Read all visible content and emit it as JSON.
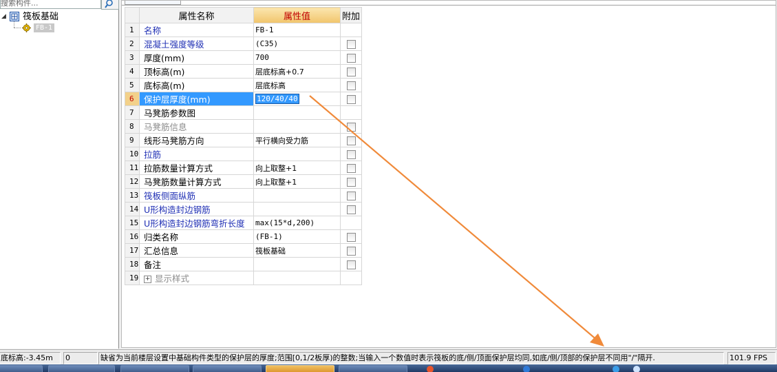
{
  "tree": {
    "search_placeholder": "搜索构件...",
    "root_label": "筏板基础",
    "child_label": "FB-1"
  },
  "grid": {
    "headers": {
      "name": "属性名称",
      "value": "属性值",
      "attach": "附加"
    },
    "rows": [
      {
        "num": "1",
        "name": "名称",
        "value": "FB-1"
      },
      {
        "num": "2",
        "name": "混凝土强度等级",
        "value": "(C35)"
      },
      {
        "num": "3",
        "name": "厚度(mm)",
        "value": "700"
      },
      {
        "num": "4",
        "name": "顶标高(m)",
        "value": "层底标高+0.7"
      },
      {
        "num": "5",
        "name": "底标高(m)",
        "value": "层底标高"
      },
      {
        "num": "6",
        "name": "保护层厚度(mm)",
        "value": "120/40/40"
      },
      {
        "num": "7",
        "name": "马凳筋参数图",
        "value": ""
      },
      {
        "num": "8",
        "name": "马凳筋信息",
        "value": ""
      },
      {
        "num": "9",
        "name": "线形马凳筋方向",
        "value": "平行横向受力筋"
      },
      {
        "num": "10",
        "name": "拉筋",
        "value": ""
      },
      {
        "num": "11",
        "name": "拉筋数量计算方式",
        "value": "向上取整+1"
      },
      {
        "num": "12",
        "name": "马凳筋数量计算方式",
        "value": "向上取整+1"
      },
      {
        "num": "13",
        "name": "筏板侧面纵筋",
        "value": ""
      },
      {
        "num": "14",
        "name": "U形构造封边钢筋",
        "value": ""
      },
      {
        "num": "15",
        "name": "U形构造封边钢筋弯折长度",
        "value": "max(15*d,200)"
      },
      {
        "num": "16",
        "name": "归类名称",
        "value": "(FB-1)"
      },
      {
        "num": "17",
        "name": "汇总信息",
        "value": "筏板基础"
      },
      {
        "num": "18",
        "name": "备注",
        "value": ""
      },
      {
        "num": "19",
        "name": "显示样式",
        "value": ""
      }
    ]
  },
  "status": {
    "elevation": "底标高:-3.45m",
    "value": "0",
    "hint": "缺省为当前楼层设置中基础构件类型的保护层的厚度;范围[0,1/2板厚)的整数;当输入一个数值时表示筏板的底/侧/顶面保护层均同,如底/侧/顶部的保护层不同用\"/\"隔开.",
    "fps": "101.9 FPS"
  },
  "colors": {
    "selection_blue": "#3399ff",
    "header_orange": "#f3c977",
    "arrow_orange": "#f08a3a",
    "link_blue": "#1f2fb4"
  }
}
